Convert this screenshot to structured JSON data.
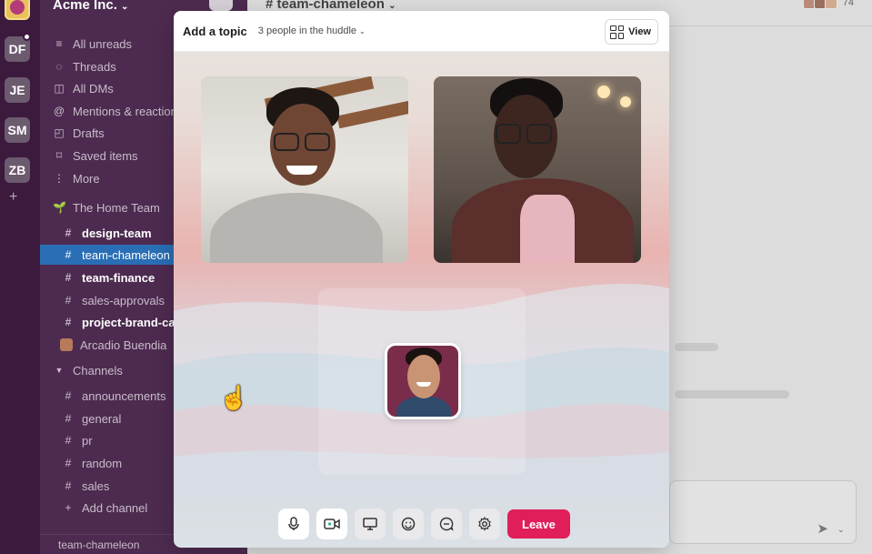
{
  "workspace": {
    "name": "Acme Inc.",
    "rail": [
      "DF",
      "JE",
      "SM",
      "ZB"
    ]
  },
  "sidebar": {
    "nav": [
      {
        "label": "All unreads",
        "icon": "unreads-icon"
      },
      {
        "label": "Threads",
        "icon": "threads-icon"
      },
      {
        "label": "All DMs",
        "icon": "dms-icon"
      },
      {
        "label": "Mentions & reactions",
        "icon": "mentions-icon"
      },
      {
        "label": "Drafts",
        "icon": "drafts-icon"
      },
      {
        "label": "Saved items",
        "icon": "bookmark-icon"
      },
      {
        "label": "More",
        "icon": "more-icon"
      }
    ],
    "section_team": "The Home Team",
    "team_channels": [
      {
        "label": "design-team",
        "bold": true
      },
      {
        "label": "team-chameleon",
        "active": true
      },
      {
        "label": "team-finance",
        "bold": true
      },
      {
        "label": "sales-approvals"
      },
      {
        "label": "project-brand-campaign",
        "bold": true
      }
    ],
    "dm_user": "Arcadio Buendia",
    "section_channels": "Channels",
    "channels": [
      "announcements",
      "general",
      "pr",
      "random",
      "sales"
    ],
    "add_channel": "Add channel",
    "footer": "team-chameleon"
  },
  "channel": {
    "title": "# team-chameleon",
    "member_count": "74"
  },
  "huddle": {
    "topic": "Add a topic",
    "people": "3 people in the huddle",
    "view_label": "View",
    "leave_label": "Leave"
  }
}
